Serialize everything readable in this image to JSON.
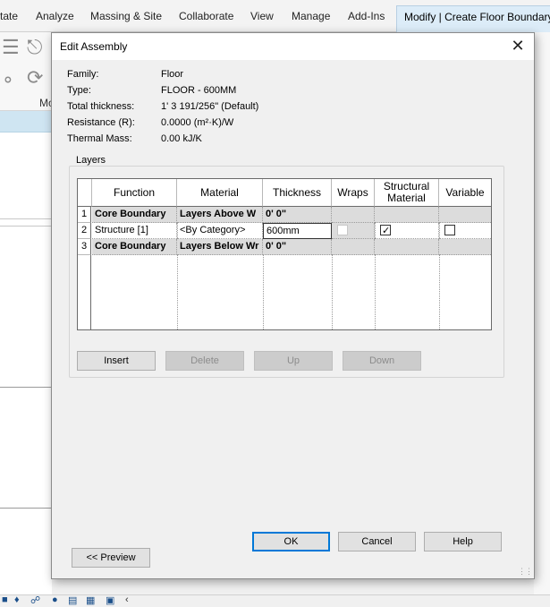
{
  "ribbon": {
    "tabs": [
      "tate",
      "Analyze",
      "Massing & Site",
      "Collaborate",
      "View",
      "Manage",
      "Add-Ins",
      "Modify | Create Floor Boundary"
    ],
    "panel_label": "Mo"
  },
  "dialog": {
    "title": "Edit Assembly",
    "properties": [
      {
        "label": "Family:",
        "value": "Floor"
      },
      {
        "label": "Type:",
        "value": "FLOOR - 600MM"
      },
      {
        "label": "Total thickness:",
        "value": "1'  3 191/256\" (Default)"
      },
      {
        "label": "Resistance (R):",
        "value": "0.0000 (m²·K)/W"
      },
      {
        "label": "Thermal Mass:",
        "value": "0.00 kJ/K"
      }
    ],
    "layers_label": "Layers",
    "columns": [
      "Function",
      "Material",
      "Thickness",
      "Wraps",
      "Structural Material",
      "Variable"
    ],
    "rows": [
      {
        "num": "1",
        "function": "Core Boundary",
        "material": "Layers Above W",
        "thickness": "0'  0\"",
        "wraps": "",
        "structural": "",
        "variable": ""
      },
      {
        "num": "2",
        "function": "Structure [1]",
        "material": "<By Category>",
        "thickness": "600mm",
        "wraps": "unchecked-disabled",
        "structural": "checked",
        "variable": "unchecked"
      },
      {
        "num": "3",
        "function": "Core Boundary",
        "material": "Layers Below Wr",
        "thickness": "0'  0\"",
        "wraps": "",
        "structural": "",
        "variable": ""
      }
    ],
    "buttons": {
      "insert": "Insert",
      "delete": "Delete",
      "up": "Up",
      "down": "Down",
      "ok": "OK",
      "cancel": "Cancel",
      "help": "Help",
      "preview": "<< Preview"
    },
    "close_icon": "close-icon"
  }
}
